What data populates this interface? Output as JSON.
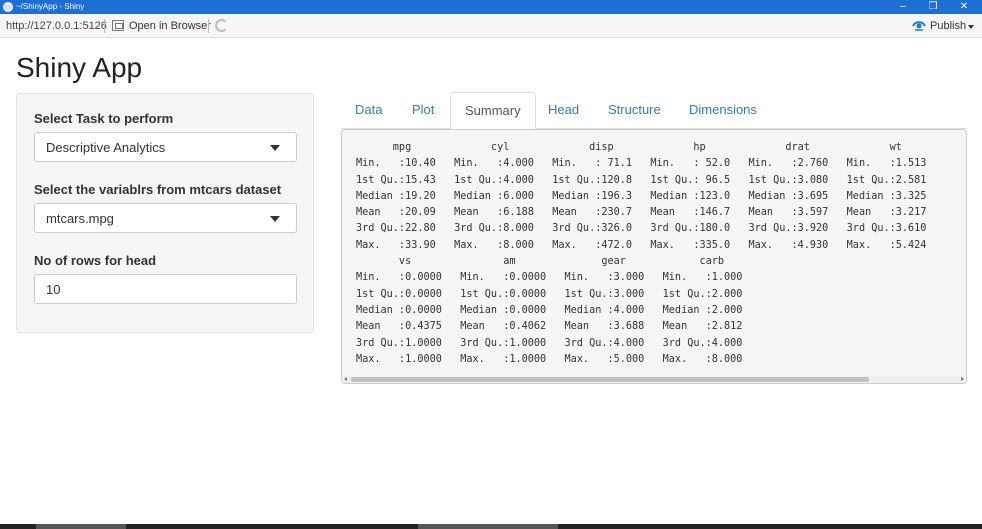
{
  "window": {
    "title": "~/ShinyApp - Shiny",
    "minimize_glyph": "–",
    "restore_glyph": "❐",
    "close_glyph": "✕"
  },
  "toolbar": {
    "url": "http://127.0.0.1:5126",
    "open_in_browser": "Open in Browser",
    "publish": "Publish",
    "publish_icon_color": "#1a7bd6"
  },
  "app": {
    "title": "Shiny App"
  },
  "sidebar": {
    "task_label": "Select Task to perform",
    "task_value": "Descriptive Analytics",
    "variable_label": "Select the variablrs from mtcars dataset",
    "variable_value": "mtcars.mpg",
    "rows_label": "No of rows for head",
    "rows_value": "10"
  },
  "tabs": [
    {
      "label": "Data"
    },
    {
      "label": "Plot"
    },
    {
      "label": "Summary",
      "active": true
    },
    {
      "label": "Head"
    },
    {
      "label": "Structure"
    },
    {
      "label": "Dimensions"
    }
  ],
  "summary_output": {
    "lines": [
      "      mpg             cyl             disp             hp             drat             wt",
      "Min.   :10.40   Min.   :4.000   Min.   : 71.1   Min.   : 52.0   Min.   :2.760   Min.   :1.513",
      "1st Qu.:15.43   1st Qu.:4.000   1st Qu.:120.8   1st Qu.: 96.5   1st Qu.:3.080   1st Qu.:2.581",
      "Median :19.20   Median :6.000   Median :196.3   Median :123.0   Median :3.695   Median :3.325",
      "Mean   :20.09   Mean   :6.188   Mean   :230.7   Mean   :146.7   Mean   :3.597   Mean   :3.217",
      "3rd Qu.:22.80   3rd Qu.:8.000   3rd Qu.:326.0   3rd Qu.:180.0   3rd Qu.:3.920   3rd Qu.:3.610",
      "Max.   :33.90   Max.   :8.000   Max.   :472.0   Max.   :335.0   Max.   :4.930   Max.   :5.424",
      "       vs               am              gear            carb",
      "Min.   :0.0000   Min.   :0.0000   Min.   :3.000   Min.   :1.000",
      "1st Qu.:0.0000   1st Qu.:0.0000   1st Qu.:3.000   1st Qu.:2.000",
      "Median :0.0000   Median :0.0000   Median :4.000   Median :2.000",
      "Mean   :0.4375   Mean   :0.4062   Mean   :3.688   Mean   :2.812",
      "3rd Qu.:1.0000   3rd Qu.:1.0000   3rd Qu.:4.000   3rd Qu.:4.000",
      "Max.   :1.0000   Max.   :1.0000   Max.   :5.000   Max.   :8.000"
    ]
  }
}
